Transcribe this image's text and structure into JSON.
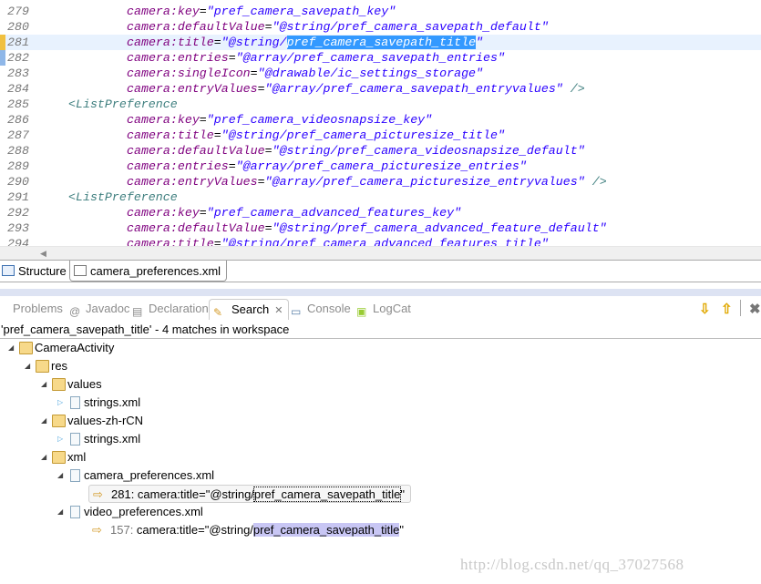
{
  "editor": {
    "lines": [
      {
        "num": "279",
        "indent": 8,
        "attr": "camera:key",
        "value": "\"pref_camera_savepath_key\""
      },
      {
        "num": "280",
        "indent": 8,
        "attr": "camera:defaultValue",
        "value": "\"@string/pref_camera_savepath_default\""
      },
      {
        "num": "281",
        "indent": 8,
        "attr": "camera:title",
        "value": "\"@string/",
        "selected": "pref_camera_savepath_title",
        "value_end": "\"",
        "current": true,
        "marker": "search-match"
      },
      {
        "num": "282",
        "indent": 8,
        "attr": "camera:entries",
        "value": "\"@array/pref_camera_savepath_entries\"",
        "marker": "change"
      },
      {
        "num": "283",
        "indent": 8,
        "attr": "camera:singleIcon",
        "value": "\"@drawable/ic_settings_storage\""
      },
      {
        "num": "284",
        "indent": 8,
        "attr": "camera:entryValues",
        "value": "\"@array/pref_camera_savepath_entryvalues\"",
        "tail": " />"
      },
      {
        "num": "285",
        "indent": 0,
        "tag": "<ListPreference"
      },
      {
        "num": "286",
        "indent": 8,
        "attr": "camera:key",
        "value": "\"pref_camera_videosnapsize_key\""
      },
      {
        "num": "287",
        "indent": 8,
        "attr": "camera:title",
        "value": "\"@string/pref_camera_picturesize_title\""
      },
      {
        "num": "288",
        "indent": 8,
        "attr": "camera:defaultValue",
        "value": "\"@string/pref_camera_videosnapsize_default\""
      },
      {
        "num": "289",
        "indent": 8,
        "attr": "camera:entries",
        "value": "\"@array/pref_camera_picturesize_entries\""
      },
      {
        "num": "290",
        "indent": 8,
        "attr": "camera:entryValues",
        "value": "\"@array/pref_camera_picturesize_entryvalues\"",
        "tail": " />"
      },
      {
        "num": "291",
        "indent": 0,
        "tag": "<ListPreference"
      },
      {
        "num": "292",
        "indent": 8,
        "attr": "camera:key",
        "value": "\"pref_camera_advanced_features_key\""
      },
      {
        "num": "293",
        "indent": 8,
        "attr": "camera:defaultValue",
        "value": "\"@string/pref_camera_advanced_feature_default\""
      },
      {
        "num": "294",
        "indent": 8,
        "attr": "camera:title",
        "value": "\"@string/pref_camera_advanced_features_title\""
      }
    ],
    "colors": {
      "attr": "#7f007f",
      "value": "#2a00ff",
      "tag": "#3f7f7f",
      "selection": "#3399ff",
      "current_line": "#e8f2fe"
    }
  },
  "editor_tabs": [
    {
      "label": "Structure",
      "icon": "structure-icon"
    },
    {
      "label": "camera_preferences.xml",
      "icon": "xml-file-icon",
      "active": true
    }
  ],
  "view_tabs": [
    {
      "label": "Problems",
      "icon": "problems-icon"
    },
    {
      "label": "Javadoc",
      "icon": "at-icon",
      "glyph": "@"
    },
    {
      "label": "Declaration",
      "icon": "declaration-icon"
    },
    {
      "label": "Search",
      "icon": "search-flashlight-icon",
      "active": true
    },
    {
      "label": "Console",
      "icon": "console-icon"
    },
    {
      "label": "LogCat",
      "icon": "logcat-icon"
    }
  ],
  "toolbar": {
    "next_match": "next-match-icon",
    "prev_match": "previous-match-icon",
    "remove": "remove-icon"
  },
  "search": {
    "summary": "'pref_camera_savepath_title' - 4 matches in workspace",
    "tree": [
      {
        "depth": 0,
        "label": "CameraActivity",
        "icon": "project-icon",
        "expanded": true
      },
      {
        "depth": 1,
        "label": "res",
        "icon": "folder-icon",
        "expanded": true
      },
      {
        "depth": 2,
        "label": "values",
        "icon": "folder-icon",
        "expanded": true
      },
      {
        "depth": 3,
        "label": "strings.xml",
        "icon": "xml-file-icon",
        "expanded": false
      },
      {
        "depth": 2,
        "label": "values-zh-rCN",
        "icon": "folder-icon",
        "expanded": true
      },
      {
        "depth": 3,
        "label": "strings.xml",
        "icon": "xml-file-icon",
        "expanded": false
      },
      {
        "depth": 2,
        "label": "xml",
        "icon": "folder-icon",
        "expanded": true
      },
      {
        "depth": 3,
        "label": "camera_preferences.xml",
        "icon": "xml-file-icon",
        "expanded": true
      },
      {
        "depth": 4,
        "match": true,
        "line": "281:",
        "pre": " camera:title=\"@string/",
        "hit": "pref_camera_savepath_title",
        "post": "\"",
        "selected": true
      },
      {
        "depth": 3,
        "label": "video_preferences.xml",
        "icon": "xml-file-icon",
        "expanded": true
      },
      {
        "depth": 4,
        "match": true,
        "line": "157:",
        "pre": " camera:title=\"@string/",
        "hit": "pref_camera_savepath_title",
        "post": "\""
      }
    ]
  },
  "watermark": "http://blog.csdn.net/qq_37027568"
}
